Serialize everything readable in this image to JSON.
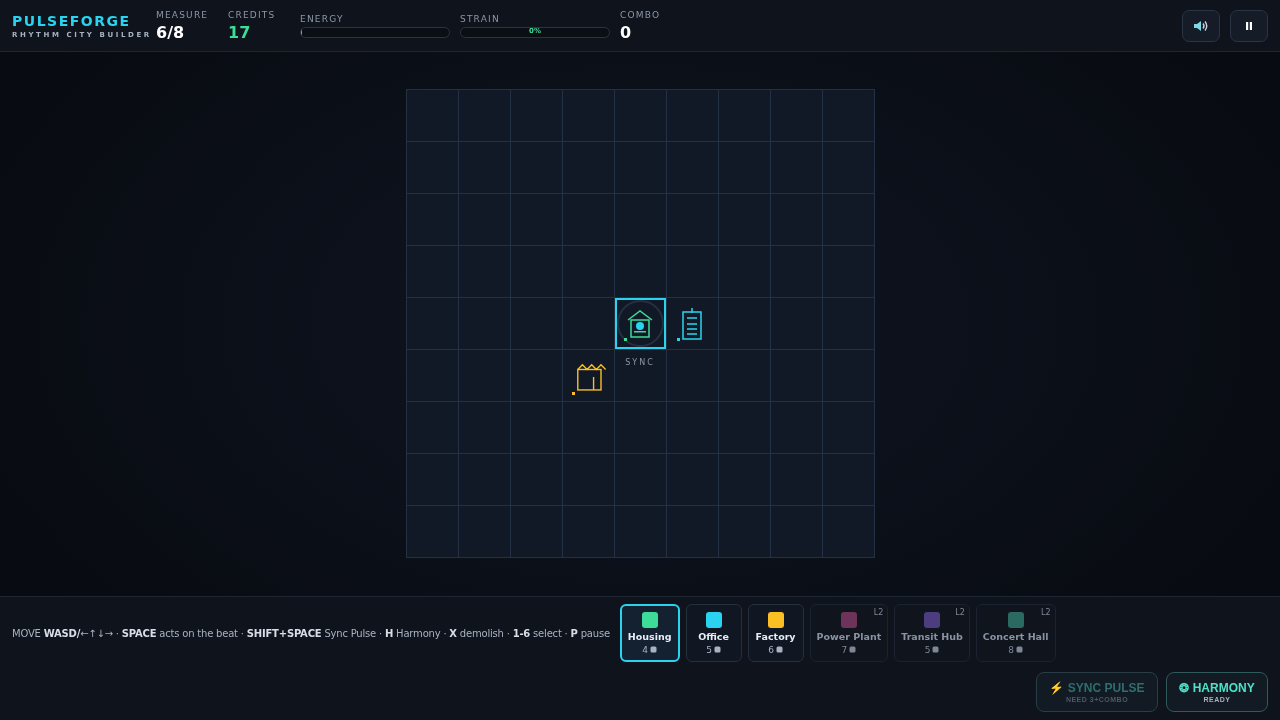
{
  "brand": {
    "title": "PULSEFORGE",
    "subtitle": "RHYTHM CITY BUILDER"
  },
  "stats": [
    {
      "kind": "value",
      "label": "MEASURE",
      "value": "6/8",
      "highlight": false
    },
    {
      "kind": "value",
      "label": "CREDITS",
      "value": "17",
      "highlight": true
    },
    {
      "kind": "meter",
      "label": "ENERGY",
      "level": 0.01
    },
    {
      "kind": "meter",
      "label": "STRAIN",
      "reading": "0%"
    },
    {
      "kind": "value",
      "label": "COMBO",
      "value": "0",
      "highlight": false
    }
  ],
  "grid": {
    "cursor_label": "SYNC",
    "rows": [
      [
        {
          "kind": "empty",
          "selected": false
        },
        {
          "kind": "empty",
          "selected": false
        },
        {
          "kind": "empty",
          "selected": false
        },
        {
          "kind": "empty",
          "selected": false
        },
        {
          "kind": "empty",
          "selected": false
        },
        {
          "kind": "empty",
          "selected": false
        },
        {
          "kind": "empty",
          "selected": false
        },
        {
          "kind": "empty",
          "selected": false
        },
        {
          "kind": "empty",
          "selected": false
        }
      ],
      [
        {
          "kind": "empty",
          "selected": false
        },
        {
          "kind": "empty",
          "selected": false
        },
        {
          "kind": "empty",
          "selected": false
        },
        {
          "kind": "empty",
          "selected": false
        },
        {
          "kind": "empty",
          "selected": false
        },
        {
          "kind": "empty",
          "selected": false
        },
        {
          "kind": "empty",
          "selected": false
        },
        {
          "kind": "empty",
          "selected": false
        },
        {
          "kind": "empty",
          "selected": false
        }
      ],
      [
        {
          "kind": "empty",
          "selected": false
        },
        {
          "kind": "empty",
          "selected": false
        },
        {
          "kind": "empty",
          "selected": false
        },
        {
          "kind": "empty",
          "selected": false
        },
        {
          "kind": "empty",
          "selected": false
        },
        {
          "kind": "empty",
          "selected": false
        },
        {
          "kind": "empty",
          "selected": false
        },
        {
          "kind": "empty",
          "selected": false
        },
        {
          "kind": "empty",
          "selected": false
        }
      ],
      [
        {
          "kind": "empty",
          "selected": false
        },
        {
          "kind": "empty",
          "selected": false
        },
        {
          "kind": "empty",
          "selected": false
        },
        {
          "kind": "empty",
          "selected": false
        },
        {
          "kind": "empty",
          "selected": false
        },
        {
          "kind": "empty",
          "selected": false
        },
        {
          "kind": "empty",
          "selected": false
        },
        {
          "kind": "empty",
          "selected": false
        },
        {
          "kind": "empty",
          "selected": false
        }
      ],
      [
        {
          "kind": "empty",
          "selected": false
        },
        {
          "kind": "empty",
          "selected": false
        },
        {
          "kind": "empty",
          "selected": false
        },
        {
          "kind": "empty",
          "selected": false
        },
        {
          "kind": "housing",
          "selected": true
        },
        {
          "kind": "office",
          "selected": false
        },
        {
          "kind": "empty",
          "selected": false
        },
        {
          "kind": "empty",
          "selected": false
        },
        {
          "kind": "empty",
          "selected": false
        }
      ],
      [
        {
          "kind": "empty",
          "selected": false
        },
        {
          "kind": "empty",
          "selected": false
        },
        {
          "kind": "empty",
          "selected": false
        },
        {
          "kind": "factory",
          "selected": false
        },
        {
          "kind": "empty",
          "selected": false
        },
        {
          "kind": "empty",
          "selected": false
        },
        {
          "kind": "empty",
          "selected": false
        },
        {
          "kind": "empty",
          "selected": false
        },
        {
          "kind": "empty",
          "selected": false
        }
      ],
      [
        {
          "kind": "empty",
          "selected": false
        },
        {
          "kind": "empty",
          "selected": false
        },
        {
          "kind": "empty",
          "selected": false
        },
        {
          "kind": "empty",
          "selected": false
        },
        {
          "kind": "empty",
          "selected": false
        },
        {
          "kind": "empty",
          "selected": false
        },
        {
          "kind": "empty",
          "selected": false
        },
        {
          "kind": "empty",
          "selected": false
        },
        {
          "kind": "empty",
          "selected": false
        }
      ],
      [
        {
          "kind": "empty",
          "selected": false
        },
        {
          "kind": "empty",
          "selected": false
        },
        {
          "kind": "empty",
          "selected": false
        },
        {
          "kind": "empty",
          "selected": false
        },
        {
          "kind": "empty",
          "selected": false
        },
        {
          "kind": "empty",
          "selected": false
        },
        {
          "kind": "empty",
          "selected": false
        },
        {
          "kind": "empty",
          "selected": false
        },
        {
          "kind": "empty",
          "selected": false
        }
      ],
      [
        {
          "kind": "empty",
          "selected": false
        },
        {
          "kind": "empty",
          "selected": false
        },
        {
          "kind": "empty",
          "selected": false
        },
        {
          "kind": "empty",
          "selected": false
        },
        {
          "kind": "empty",
          "selected": false
        },
        {
          "kind": "empty",
          "selected": false
        },
        {
          "kind": "empty",
          "selected": false
        },
        {
          "kind": "empty",
          "selected": false
        },
        {
          "kind": "empty",
          "selected": false
        }
      ]
    ]
  },
  "hint": "MOVE **WASD/**←↑↓→ · **SPACE** acts on the beat · **SHIFT+SPACE** Sync Pulse · **H** Harmony · **X** demolish · **1-6** select · **P** pause",
  "palette": [
    {
      "name": "Housing",
      "cost": "4",
      "color": "#3ddc97",
      "selected": true,
      "locked": false
    },
    {
      "name": "Office",
      "cost": "5",
      "color": "#2ad4f0",
      "selected": false,
      "locked": false
    },
    {
      "name": "Factory",
      "cost": "6",
      "color": "#fbbf24",
      "selected": false,
      "locked": false
    },
    {
      "name": "Power Plant",
      "cost": "7",
      "color": "#6e3358",
      "selected": false,
      "locked": true,
      "tier": "L2"
    },
    {
      "name": "Transit Hub",
      "cost": "5",
      "color": "#4c3d80",
      "selected": false,
      "locked": true,
      "tier": "L2"
    },
    {
      "name": "Concert Hall",
      "cost": "8",
      "color": "#2a6a60",
      "selected": false,
      "locked": true,
      "tier": "L2"
    }
  ],
  "actions": [
    {
      "kind": "sync",
      "icon": "⚡",
      "label": "SYNC PULSE",
      "sub": "NEED 3+COMBO",
      "disabled": true
    },
    {
      "kind": "harmony",
      "icon": "❂",
      "label": "HARMONY",
      "sub": "READY",
      "disabled": false
    }
  ]
}
